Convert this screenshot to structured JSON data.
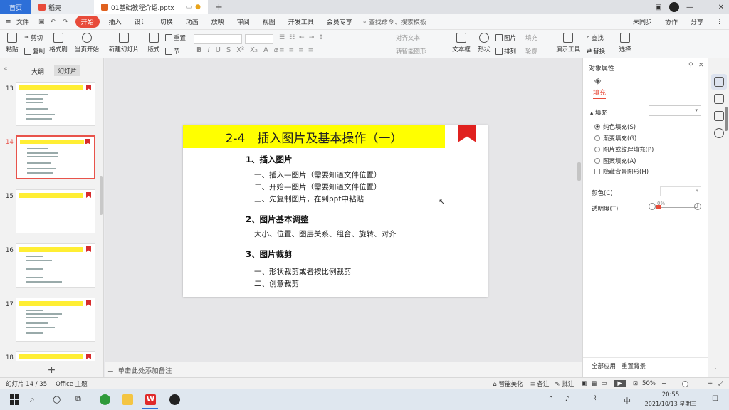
{
  "tabs": {
    "home": "首页",
    "daoke": "稻壳",
    "doc": "01基础教程介绍.pptx",
    "add": "+"
  },
  "menus": [
    "文件",
    "开始",
    "插入",
    "设计",
    "切换",
    "动画",
    "放映",
    "审阅",
    "视图",
    "开发工具",
    "会员专享"
  ],
  "search_placeholder": "查找命令、搜索模板",
  "topright": {
    "sync": "未同步",
    "collab": "协作",
    "share": "分享"
  },
  "ribbon": {
    "paste": "粘贴",
    "cut": "剪切",
    "copy": "复制",
    "format_painter": "格式刷",
    "from_current": "当页开始",
    "new_slide": "新建幻灯片",
    "layout": "版式",
    "section": "节",
    "reset": "重置",
    "text_box": "文本框",
    "shape": "形状",
    "arrange": "排列",
    "picture": "图片",
    "fill": "填充",
    "outline": "轮廓",
    "align_text": "对齐文本",
    "smartart": "转智能图形",
    "find": "查找",
    "replace": "替换",
    "select": "选择",
    "presenter_tools": "演示工具"
  },
  "left_panel": {
    "tab_outline": "大纲",
    "tab_slides": "幻灯片",
    "add": "+",
    "thumbs": [
      {
        "num": "13",
        "title": "2-3 插入并排列基本操作（二）"
      },
      {
        "num": "14",
        "title": "2-4 插入图片及基本操作（一）"
      },
      {
        "num": "15",
        "title": ""
      },
      {
        "num": "16",
        "title": "2-5 插入图形及基本操作（二）"
      },
      {
        "num": "17",
        "title": "2-6 插入声频及基本操作"
      },
      {
        "num": "18",
        "title": "2-7 插入视频及基本操作"
      }
    ]
  },
  "slide": {
    "title": "2-4　插入图片及基本操作（一）",
    "sections": [
      {
        "heading": "1、插入图片",
        "lines": [
          "一、插入—图片（需要知道文件位置）",
          "二、开始—图片（需要知道文件位置）",
          "三、先复制图片，在到ppt中粘贴"
        ]
      },
      {
        "heading": "2、图片基本调整",
        "lines": [
          "大小、位置、图层关系、组合、旋转、对齐"
        ]
      },
      {
        "heading": "3、图片裁剪",
        "lines": [
          "一、形状裁剪或者按比例裁剪",
          "二、创意裁剪"
        ]
      }
    ]
  },
  "notes_placeholder": "单击此处添加备注",
  "right_panel": {
    "title": "对象属性",
    "tab_fill": "填充",
    "section_fill": "填充",
    "options": [
      "纯色填充(S)",
      "渐变填充(G)",
      "图片或纹理填充(P)",
      "图案填充(A)",
      "隐藏背景图形(H)"
    ],
    "color_label": "颜色(C)",
    "transparency_label": "透明度(T)",
    "transparency_value": "0%",
    "apply_all": "全部应用",
    "reset_bg": "重置背景"
  },
  "status": {
    "slide_counter": "幻灯片 14 / 35",
    "theme": "Office 主题",
    "beautify": "智能美化",
    "notes": "备注",
    "comments": "批注",
    "zoom": "50%"
  },
  "taskbar": {
    "time": "20:55",
    "date": "2021/10/13 星期三",
    "ime": "中"
  },
  "colors": {
    "accent": "#e84b3a",
    "title_bg": "#ffff00",
    "bookmark": "#e0211f",
    "home_tab": "#2d6fd8"
  }
}
